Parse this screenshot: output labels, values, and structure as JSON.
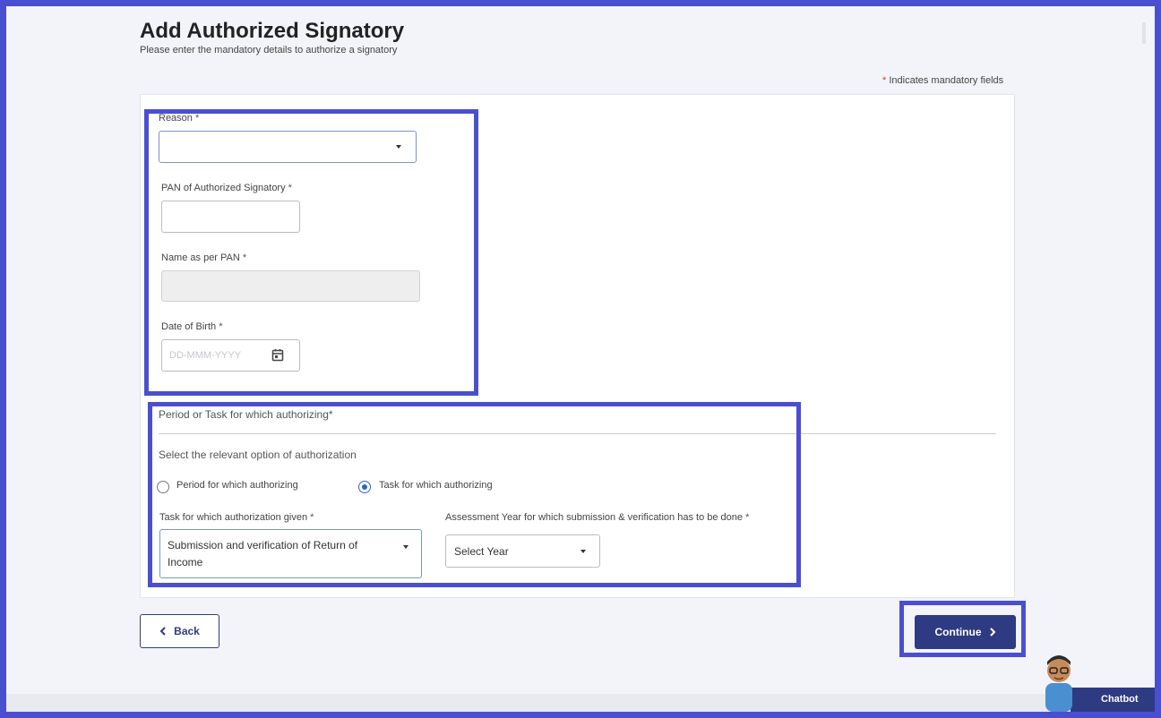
{
  "header": {
    "title": "Add Authorized Signatory",
    "subtitle": "Please enter the mandatory details to authorize a signatory",
    "mandatory_note": "Indicates mandatory fields",
    "mandatory_star": "*"
  },
  "form": {
    "reason": {
      "label": "Reason",
      "star": "*",
      "value": ""
    },
    "pan": {
      "label": "PAN of Authorized Signatory",
      "star": "*",
      "value": ""
    },
    "name": {
      "label": "Name as per PAN",
      "star": "*",
      "value": ""
    },
    "dob": {
      "label": "Date of Birth",
      "star": "*",
      "placeholder": "DD-MMM-YYYY"
    }
  },
  "authorization": {
    "section_title": "Period or Task for which authorizing*",
    "prompt": "Select the relevant option of authorization",
    "options": [
      {
        "label": "Period for which authorizing",
        "selected": false
      },
      {
        "label": "Task for which authorizing",
        "selected": true
      }
    ],
    "task": {
      "label": "Task for which authorization given",
      "star": "*",
      "value_line1": "Submission and verification of Return of",
      "value_line2": "Income"
    },
    "assessment_year": {
      "label": "Assessment Year for which submission & verification has to be done",
      "star": "*",
      "value": "Select Year"
    }
  },
  "actions": {
    "back_label": "Back",
    "continue_label": "Continue"
  },
  "chatbot": {
    "label": "Chatbot"
  },
  "colors": {
    "highlight": "#4a4fd0",
    "primary": "#2e3a82",
    "radio_selected": "#2f64c8"
  },
  "icons": [
    "calendar-icon",
    "chevron-left-icon",
    "chevron-right-icon",
    "caret-down-icon",
    "chatbot-avatar-icon"
  ]
}
